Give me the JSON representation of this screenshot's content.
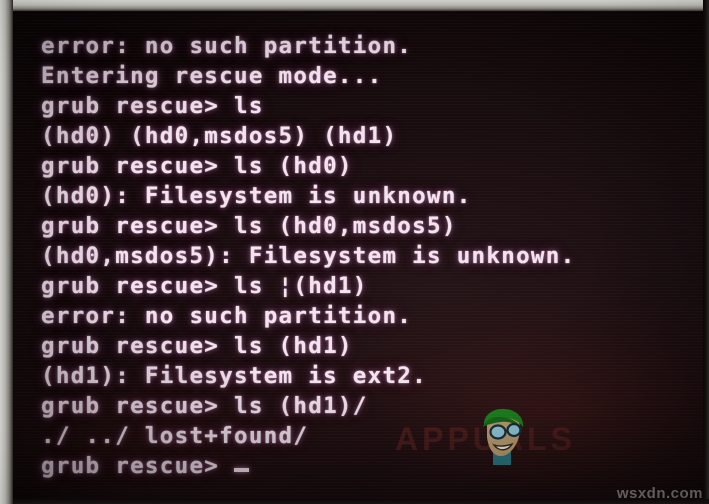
{
  "screen": {
    "kind": "grub-rescue-console",
    "background_color": "#120809",
    "text_color": "#f4e3ef",
    "glow_color": "#e4a0d7"
  },
  "console": {
    "lines": [
      {
        "text": "error: no such partition.",
        "cursor": false
      },
      {
        "text": "Entering rescue mode...",
        "cursor": false
      },
      {
        "text": "grub rescue> ls",
        "cursor": false
      },
      {
        "text": "(hd0) (hd0,msdos5) (hd1)",
        "cursor": false
      },
      {
        "text": "grub rescue> ls (hd0)",
        "cursor": false
      },
      {
        "text": "(hd0): Filesystem is unknown.",
        "cursor": false
      },
      {
        "text": "grub rescue> ls (hd0,msdos5)",
        "cursor": false
      },
      {
        "text": "(hd0,msdos5): Filesystem is unknown.",
        "cursor": false
      },
      {
        "text": "grub rescue> ls ¦(hd1)",
        "cursor": false
      },
      {
        "text": "error: no such partition.",
        "cursor": false
      },
      {
        "text": "grub rescue> ls (hd1)",
        "cursor": false
      },
      {
        "text": "(hd1): Filesystem is ext2.",
        "cursor": false
      },
      {
        "text": "grub rescue> ls (hd1)/",
        "cursor": false
      },
      {
        "text": "./ ../ lost+found/",
        "cursor": false
      },
      {
        "text": "grub rescue> ",
        "cursor": true
      }
    ]
  },
  "watermark": {
    "label": "APPUALS",
    "color": "#782c28",
    "mascot": "cartoon-face-green-hair-glasses"
  },
  "credit": {
    "label": "wsxdn.com",
    "color": "#969492"
  }
}
